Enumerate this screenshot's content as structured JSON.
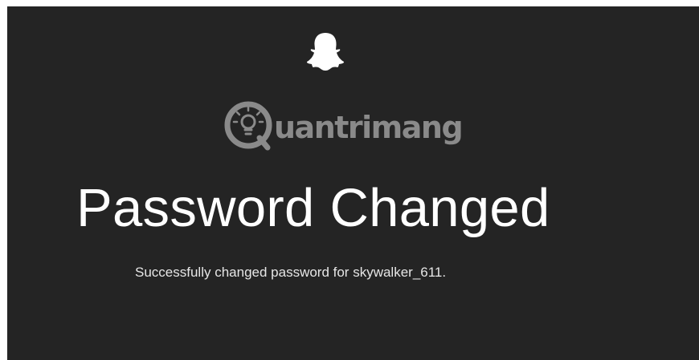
{
  "page": {
    "title": "Password Changed",
    "message": "Successfully changed password for skywalker_611."
  },
  "brand": {
    "logo_icon": "snapchat-ghost-icon",
    "watermark_text": "Quantrimang"
  },
  "colors": {
    "background": "#242424",
    "title_text": "#ffffff",
    "message_text": "#e6e6e6",
    "watermark": "#8a8a8a"
  }
}
